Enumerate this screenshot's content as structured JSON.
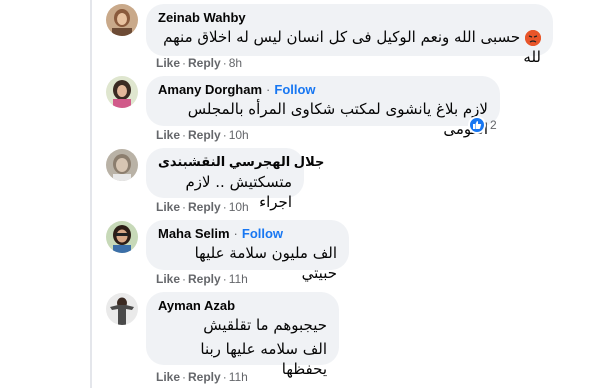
{
  "comments": [
    {
      "author": "Zeinab Wahby",
      "text": "حسبى الله ونعم الوكيل فى كل انسان ليس له اخلاق منهم لله",
      "emoji": "angry-face",
      "like": "Like",
      "reply": "Reply",
      "time": "8h"
    },
    {
      "author": "Amany Dorgham",
      "follow": "Follow",
      "text": "لازم بلاغ يانشوى لمكتب شكاوى المرأه بالمجلس القومى",
      "reactions": "2",
      "like": "Like",
      "reply": "Reply",
      "time": "10h"
    },
    {
      "author": "جلال الهجرسي النقشبندى",
      "text": "متسكتيش .. لازم اجراء",
      "like": "Like",
      "reply": "Reply",
      "time": "10h"
    },
    {
      "author": "Maha Selim",
      "follow": "Follow",
      "text": "الف مليون سلامة عليها حبيتي",
      "like": "Like",
      "reply": "Reply",
      "time": "11h"
    },
    {
      "author": "Ayman Azab",
      "text_line1": "حيجبوهم ما تقلقيش",
      "text_line2": "الف سلامه عليها ربنا يحفظها",
      "like": "Like",
      "reply": "Reply",
      "time": "11h"
    }
  ],
  "colors": {
    "accent": "#1877f2",
    "bubble": "#f0f2f5",
    "meta": "#65676b"
  }
}
